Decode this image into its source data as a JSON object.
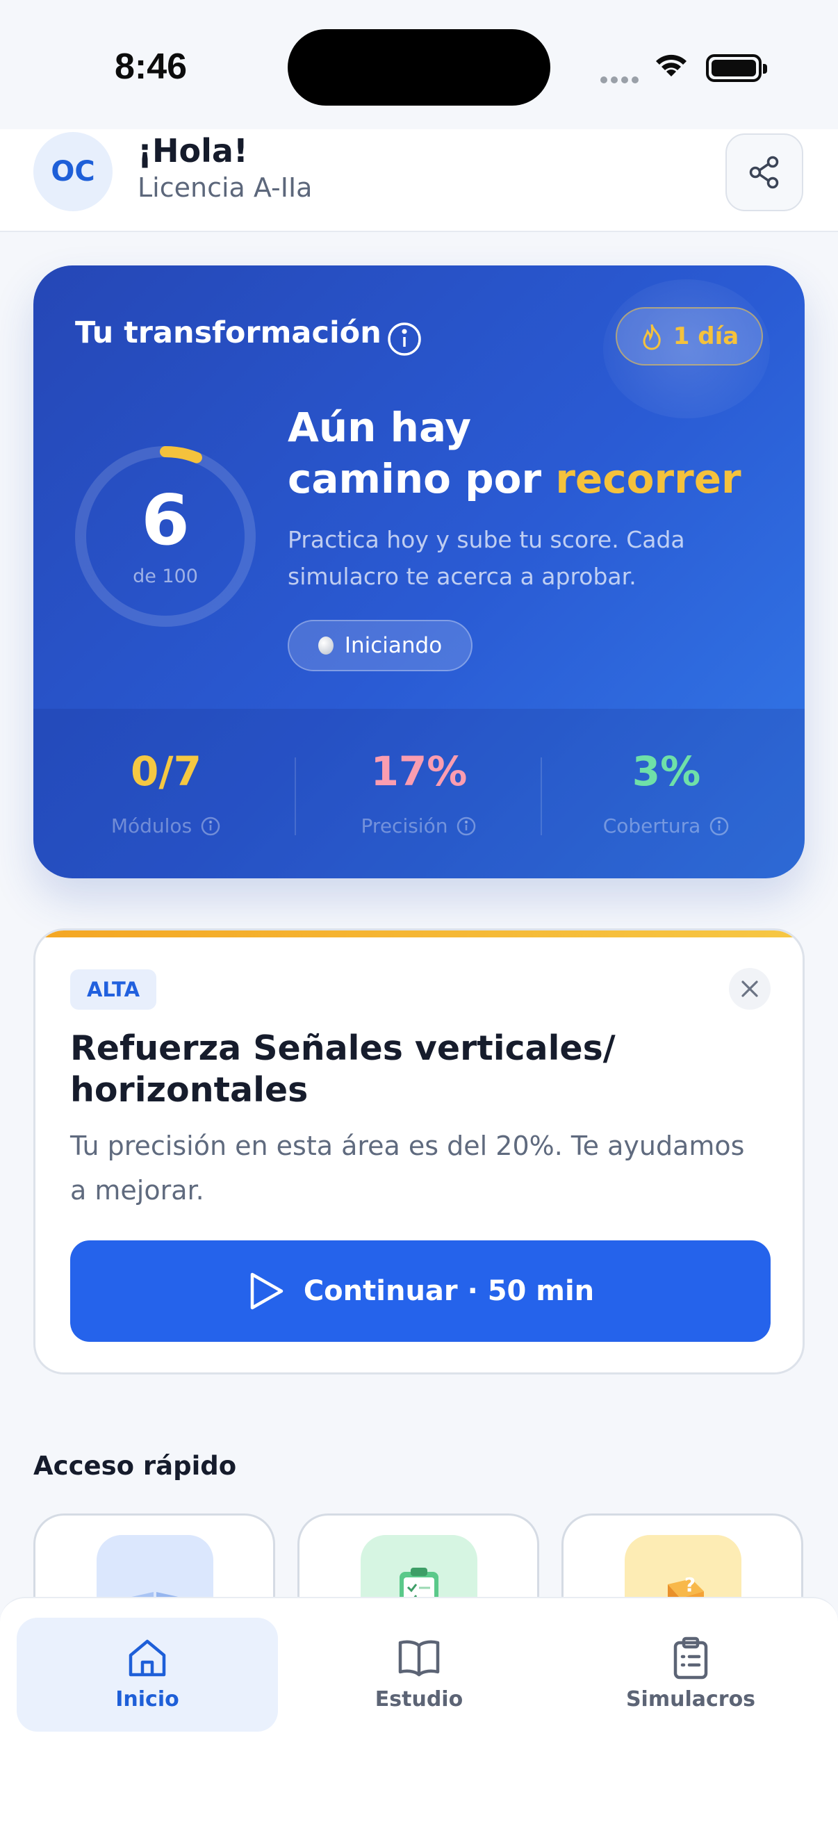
{
  "status_bar": {
    "time": "8:46"
  },
  "header": {
    "avatar_initials": "OC",
    "greeting": "¡Hola!",
    "license": "Licencia A-IIa"
  },
  "transformation": {
    "title": "Tu transformación",
    "streak": "1 día",
    "score": "6",
    "score_of": "de 100",
    "score_progress": 0.06,
    "headline_line1": "Aún hay",
    "headline_line2_a": "camino por ",
    "headline_line2_b": "recorrer",
    "description": "Practica hoy y sube tu score. Cada simulacro te acerca a aprobar.",
    "level": "Iniciando",
    "stats": [
      {
        "value": "0/7",
        "label": "Módulos",
        "color": "#f5c842"
      },
      {
        "value": "17%",
        "label": "Precisión",
        "color": "#fb9db0"
      },
      {
        "value": "3%",
        "label": "Cobertura",
        "color": "#6fe0a8"
      }
    ]
  },
  "recommendation": {
    "priority": "ALTA",
    "title": "Refuerza Señales verticales/ horizontales",
    "description": "Tu precisión en esta área es del 20%. Te ayudamos a mejorar.",
    "cta": "Continuar · 50 min"
  },
  "quick_access": {
    "title": "Acceso rápido",
    "items": [
      {
        "icon": "book-icon"
      },
      {
        "icon": "clipboard-check-icon"
      },
      {
        "icon": "question-cube-icon"
      }
    ]
  },
  "bottom_nav": {
    "items": [
      {
        "label": "Inicio",
        "icon": "home-icon",
        "active": true
      },
      {
        "label": "Estudio",
        "icon": "book-open-icon",
        "active": false
      },
      {
        "label": "Simulacros",
        "icon": "clipboard-list-icon",
        "active": false
      }
    ]
  },
  "colors": {
    "primary": "#2563eb",
    "accent_yellow": "#f5c23c",
    "card_gradient_start": "#2547b6",
    "card_gradient_end": "#3379e8"
  }
}
